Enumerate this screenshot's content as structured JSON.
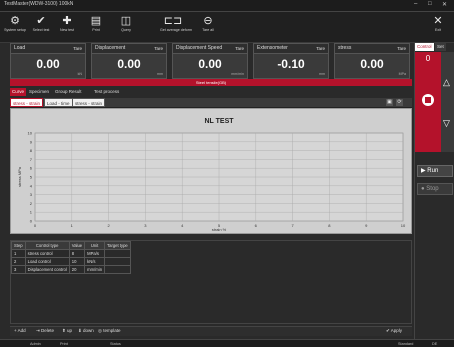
{
  "window": {
    "title": "TestMaster(WDW-3100) 100kN",
    "controls": [
      "–",
      "□",
      "✕"
    ]
  },
  "toolbar": {
    "items": [
      {
        "label": "System setup",
        "icon": "system-setup-icon"
      },
      {
        "label": "Select test",
        "icon": "select-test-icon"
      },
      {
        "label": "New test",
        "icon": "new-test-icon"
      },
      {
        "label": "Print",
        "icon": "print-icon"
      },
      {
        "label": "Query",
        "icon": "query-icon"
      },
      {
        "label": "Get average deform",
        "icon": "average-deform-icon"
      },
      {
        "label": "Tare all",
        "icon": "tare-all-icon"
      }
    ],
    "exit_label": "Exit"
  },
  "meters": [
    {
      "name": "Load",
      "tare": "Tare",
      "value": "0.00",
      "unit": "kN"
    },
    {
      "name": "Displacement",
      "tare": "Tare",
      "value": "0.00",
      "unit": "mm"
    },
    {
      "name": "Displacement Speed",
      "tare": "Tare",
      "value": "0.00",
      "unit": "mm/min"
    },
    {
      "name": "Extensometer",
      "tare": "Tare",
      "value": "-0.10",
      "unit": "mm"
    },
    {
      "name": "stress",
      "tare": "Tare",
      "value": "0.00",
      "unit": "MPa"
    }
  ],
  "status_banner": "Steel tensile(GB)",
  "tabs_main": [
    "Curve",
    "Specimen",
    "Group Result",
    "Test process"
  ],
  "tabs_curve": [
    "stress - strain",
    "Load - time",
    "stress - strain"
  ],
  "chart_data": {
    "type": "line",
    "title": "NL TEST",
    "xlabel": "strain %",
    "ylabel": "stress MPa",
    "x_ticks": [
      "0",
      "1",
      "2",
      "3",
      "4",
      "5",
      "6",
      "7",
      "8",
      "9",
      "10"
    ],
    "y_ticks": [
      "0",
      "1",
      "2",
      "3",
      "4",
      "5",
      "6",
      "7",
      "8",
      "9",
      "10"
    ],
    "series": [],
    "grid": true
  },
  "steps_table": {
    "headers": [
      "Step",
      "Control type",
      "Value",
      "Unit",
      "Target type"
    ],
    "rows": [
      [
        "1",
        "stress control",
        "8",
        "MPa/s",
        ""
      ],
      [
        "2",
        "Load control",
        "10",
        "kN/s",
        ""
      ],
      [
        "3",
        "Displacement control",
        "20",
        "mm/min",
        ""
      ]
    ]
  },
  "bottom_bar": {
    "add": "Add",
    "delete": "Delete",
    "up": "up",
    "down": "down",
    "template": "template",
    "apply": "Apply"
  },
  "status_bar": {
    "left1": "Admin",
    "left2": "Print",
    "mid": "Status",
    "right1": "Standard",
    "right2": "DE"
  },
  "right_panel": {
    "tabs": [
      "Control",
      "Set"
    ],
    "counter": "0",
    "run_label": "Run",
    "stop_label": "Stop"
  }
}
